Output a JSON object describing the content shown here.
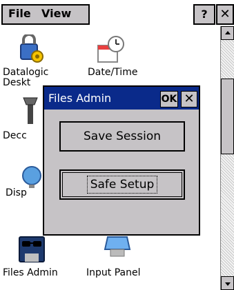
{
  "menubar": {
    "file_label": "File",
    "view_label": "View",
    "help_label": "?",
    "close_label": "✕"
  },
  "desktop": {
    "icons": [
      {
        "label": "Datalogic",
        "icon": "lock-gear-icon"
      },
      {
        "label": "Date/Time",
        "icon": "calendar-clock-icon"
      },
      {
        "label": "Deskt",
        "icon": ""
      },
      {
        "label": "Decc",
        "icon": "tools-icon"
      },
      {
        "label": "Disp",
        "icon": "display-icon"
      },
      {
        "label": "Files Admin",
        "icon": "floppy-disk-icon"
      },
      {
        "label": "Input Panel",
        "icon": "keyboard-monitor-icon"
      }
    ]
  },
  "dialog": {
    "title": "Files Admin",
    "ok_label": "OK",
    "close_label": "✕",
    "buttons": [
      {
        "label": "Save Session"
      },
      {
        "label": "Safe Setup"
      }
    ]
  },
  "colors": {
    "title_bar": "#0a2a8a",
    "chrome": "#c6c3c6"
  }
}
